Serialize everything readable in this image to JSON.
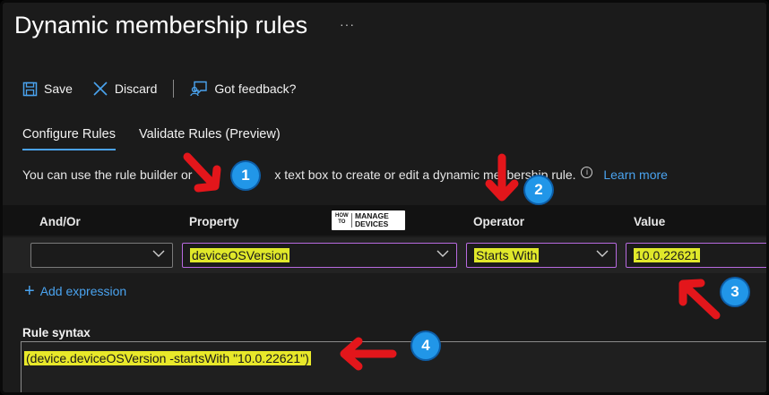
{
  "header": {
    "title": "Dynamic membership rules",
    "more": "···"
  },
  "toolbar": {
    "save": "Save",
    "discard": "Discard",
    "feedback": "Got feedback?"
  },
  "tabs": [
    {
      "label": "Configure Rules",
      "active": true
    },
    {
      "label": "Validate Rules (Preview)",
      "active": false
    }
  ],
  "info": {
    "text": "You can use the rule builder or the rule syntax text box to create or edit a dynamic membership rule.",
    "text_left": "You can use the rule builder or",
    "text_mid": "x text box to create or edit a dynamic me",
    "text_right": "bership rule.",
    "learn_more": "Learn more"
  },
  "grid": {
    "headers": {
      "andor": "And/Or",
      "property": "Property",
      "operator": "Operator",
      "value": "Value"
    },
    "row": {
      "andor": "",
      "property": "deviceOSVersion",
      "operator": "Starts With",
      "value": "10.0.22621"
    }
  },
  "add_expression": "Add expression",
  "rule_syntax": {
    "label": "Rule syntax",
    "text": "(device.deviceOSVersion -startsWith \"10.0.22621\")"
  },
  "logo": {
    "small": "HOW\nTO",
    "big_1": "MANAGE",
    "big_2": "DEVICES"
  },
  "badges": [
    "1",
    "2",
    "3",
    "4"
  ],
  "colors": {
    "accent": "#4aa3ef",
    "highlight": "#e0e82a",
    "annotation_red": "#e3161b",
    "badge_blue": "#2196e8",
    "background": "#1b1b1b"
  }
}
